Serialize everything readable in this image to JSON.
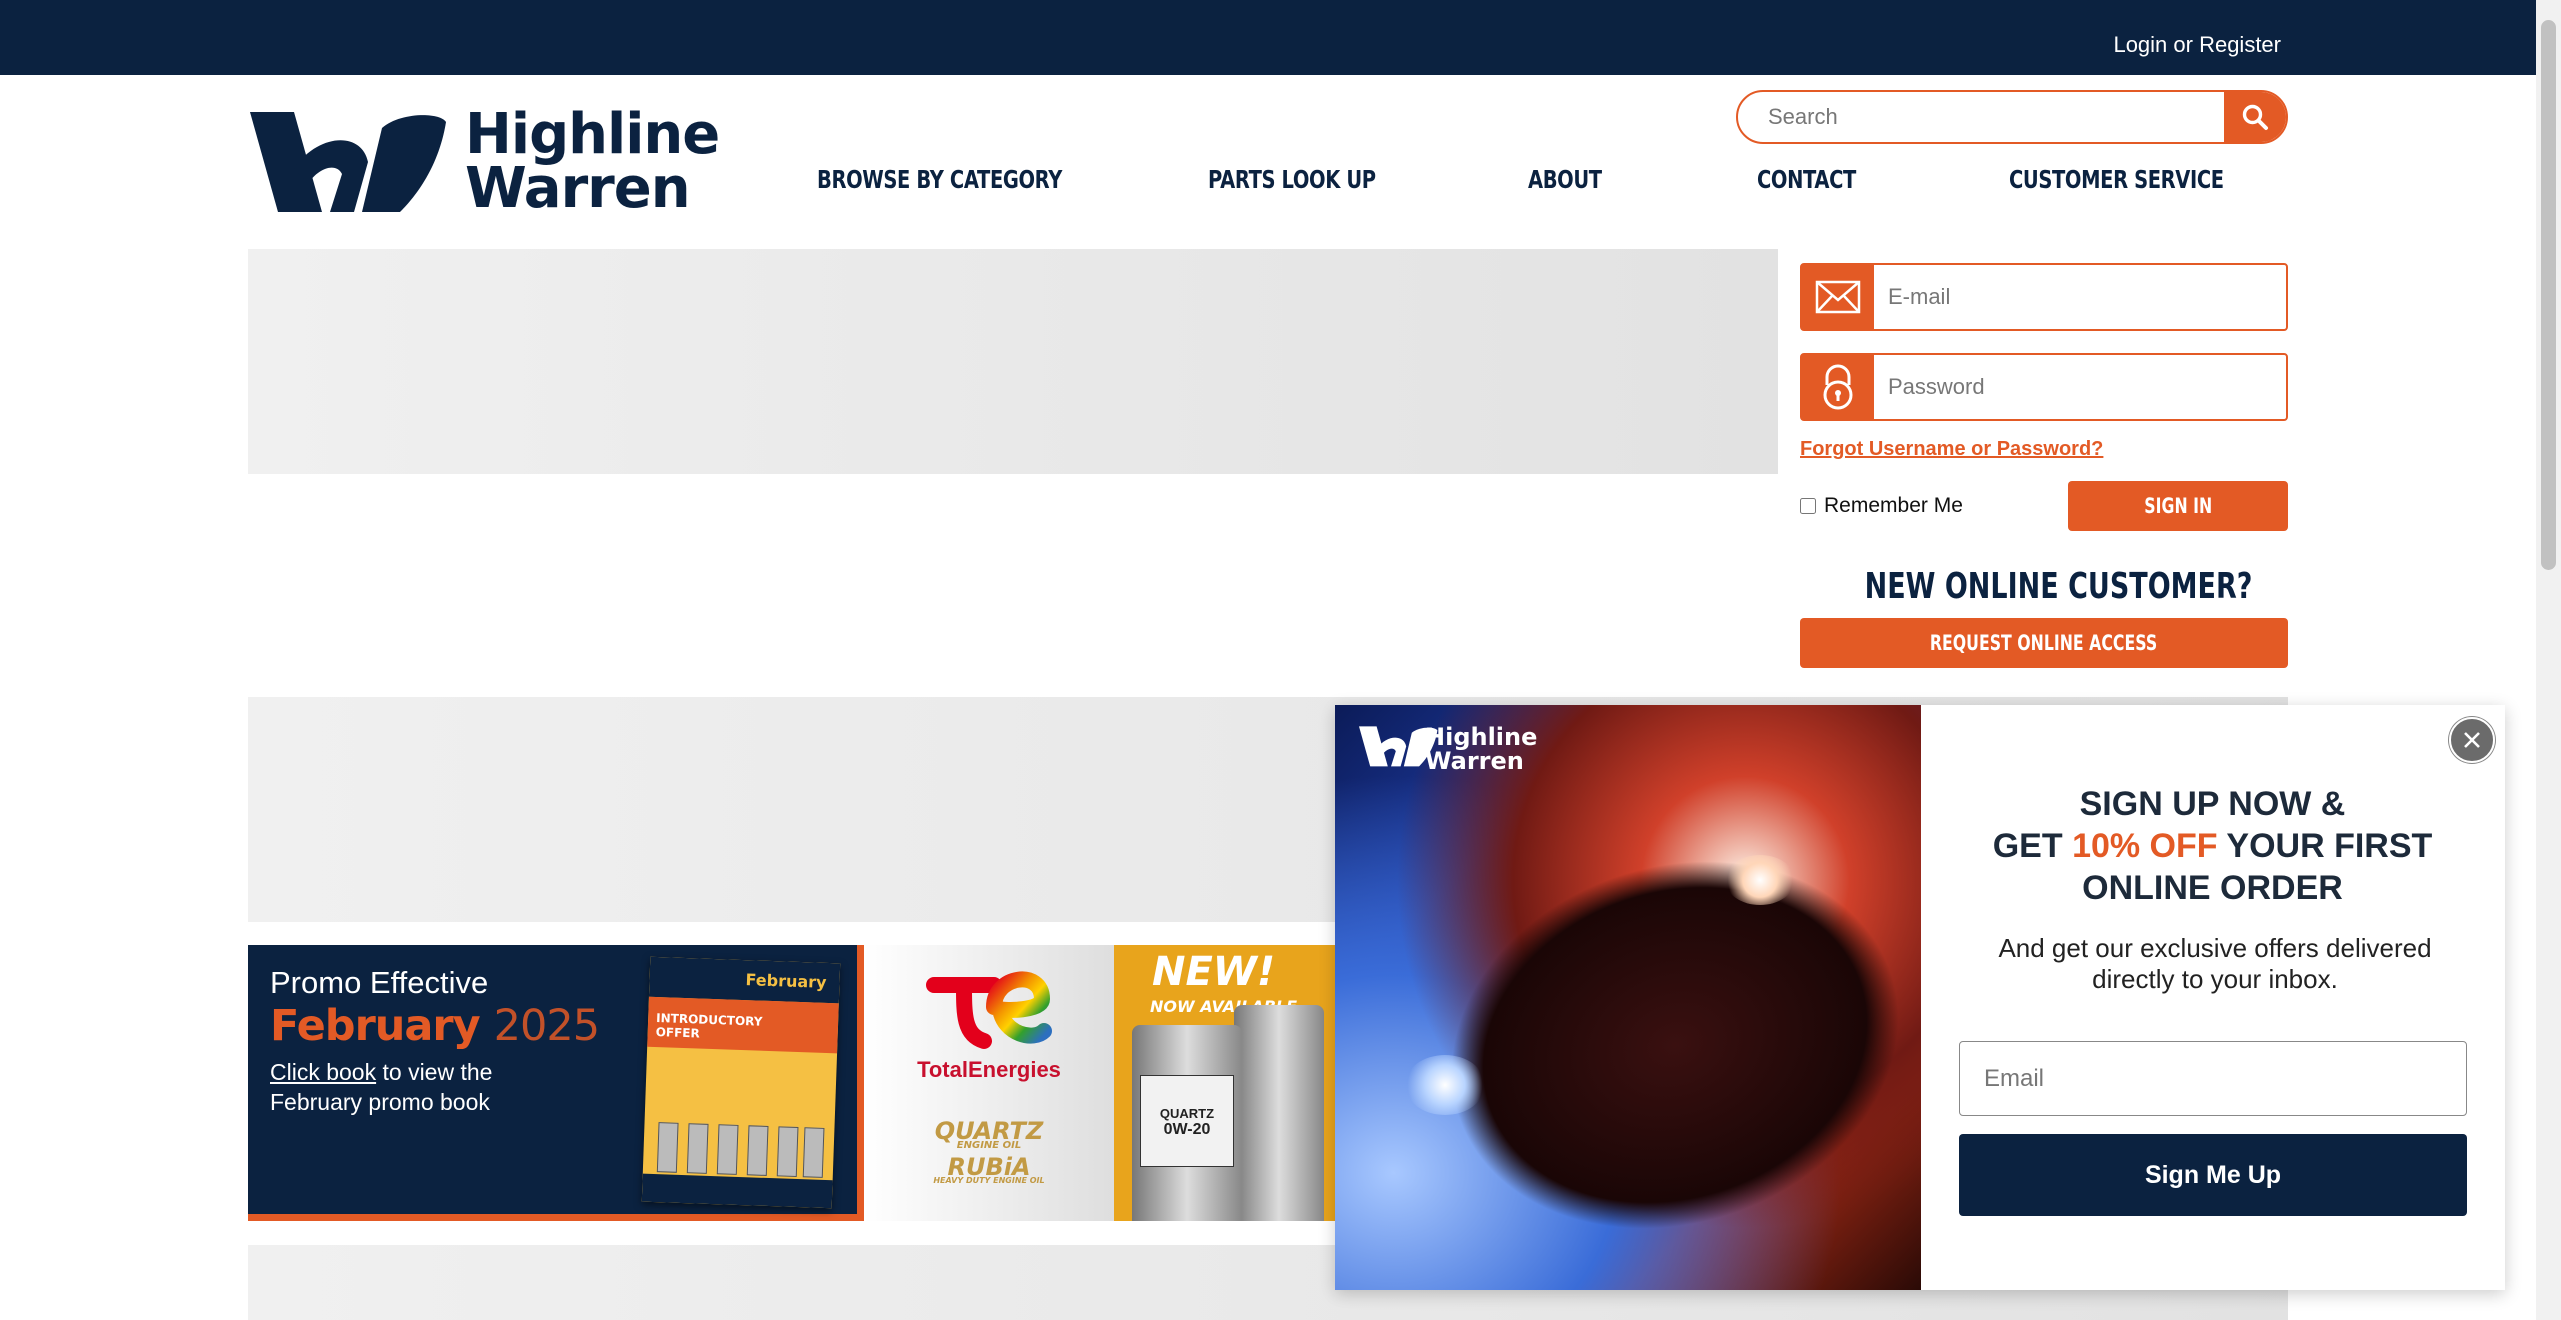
{
  "header": {
    "login_label": "Login or Register",
    "logo_line1": "Highline",
    "logo_line2": "Warren"
  },
  "search": {
    "placeholder": "Search",
    "icon": "search-icon"
  },
  "nav": {
    "items": [
      {
        "label": "BROWSE BY CATEGORY"
      },
      {
        "label": "PARTS LOOK UP"
      },
      {
        "label": "ABOUT"
      },
      {
        "label": "CONTACT"
      },
      {
        "label": "CUSTOMER SERVICE"
      }
    ]
  },
  "login_form": {
    "email_placeholder": "E-mail",
    "email_icon": "envelope-icon",
    "password_placeholder": "Password",
    "password_icon": "lock-icon",
    "forgot_label": "Forgot Username or Password?",
    "remember_label": "Remember Me",
    "remember_checked": false,
    "signin_label": "SIGN IN",
    "new_customer_heading": "NEW ONLINE CUSTOMER?",
    "request_label": "REQUEST ONLINE ACCESS"
  },
  "promo": {
    "line1": "Promo Effective",
    "month": "February",
    "year": "2025",
    "click_link": "Click book",
    "click_rest": "to view the February promo book",
    "booklet_title": "February",
    "booklet_badge": "INTRODUCTORY OFFER",
    "brand_name": "TotalEnergies",
    "product1": "QUARTZ",
    "product1_sub": "ENGINE OIL",
    "product2": "RUBiA",
    "product2_sub": "HEAVY DUTY ENGINE OIL",
    "new_label": "NEW!",
    "new_sub": "NOW AVAILABLE",
    "bottle_label": "QUARTZ",
    "bottle_grade": "0W-20"
  },
  "popup": {
    "logo_line1": "Highline",
    "logo_line2": "Warren",
    "heading_line1": "SIGN UP NOW &",
    "heading_get": "GET",
    "heading_accent": "10% OFF",
    "heading_rest": "YOUR FIRST",
    "heading_line3": "ONLINE ORDER",
    "subtext": "And get our exclusive offers delivered directly to your inbox.",
    "email_placeholder": "Email",
    "button_label": "Sign Me Up",
    "close_icon": "close-icon"
  },
  "colors": {
    "navy": "#0b2240",
    "accent": "#e35a25",
    "page_bg": "#ffffff"
  }
}
